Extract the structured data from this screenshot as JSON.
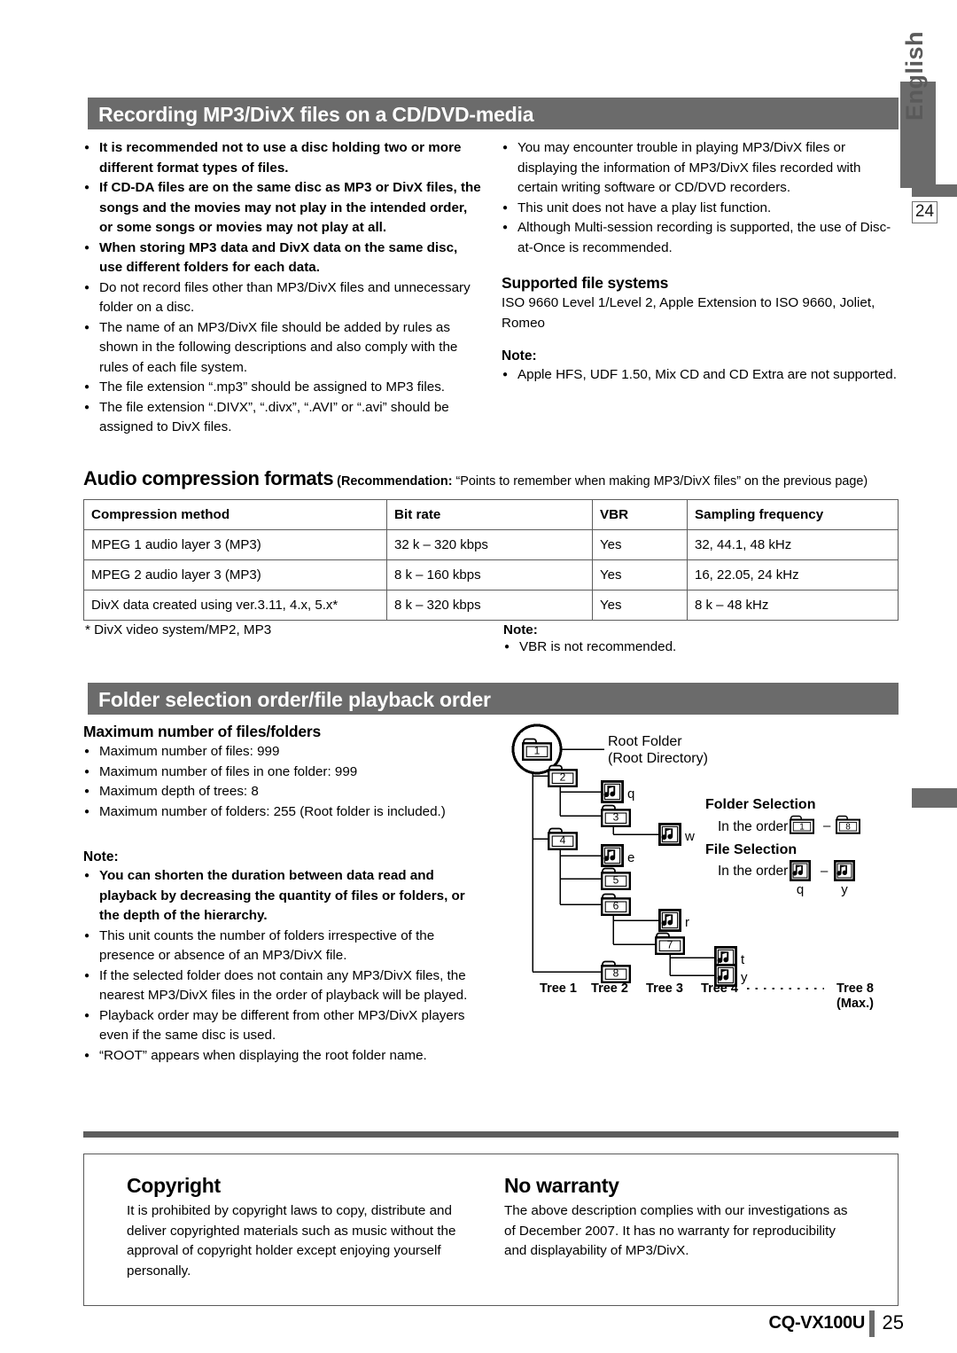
{
  "sidebar": {
    "language_label": "English",
    "page_reference": "24"
  },
  "sections": [
    {
      "id": "recording",
      "title": "Recording MP3/DivX files on a CD/DVD-media"
    },
    {
      "id": "folder-order",
      "title": "Folder selection order/file playback order"
    }
  ],
  "recording": {
    "left_bullets": [
      {
        "text": "It is recommended not to use a disc holding two or more different format types of files.",
        "bold": true
      },
      {
        "text": "If CD-DA files are on the same disc as MP3 or DivX files, the songs and the movies may not play in the intended order, or some songs or movies may not play at all.",
        "bold": true
      },
      {
        "text": "When storing MP3 data and DivX data on the same disc, use different folders for each data.",
        "bold": true
      },
      {
        "text": "Do not record files other than MP3/DivX files and unnecessary folder on a disc.",
        "bold": false
      },
      {
        "text": "The name of an MP3/DivX file should be added by rules as shown in the following descriptions and also comply with the rules of each file system.",
        "bold": false
      },
      {
        "text": "The file extension “.mp3” should be assigned to MP3 files.",
        "bold": false
      },
      {
        "text": "The file extension “.DIVX”, “.divx”, “.AVI” or “.avi” should be assigned to DivX files.",
        "bold": false
      }
    ],
    "right_bullets": [
      {
        "text": "You may encounter trouble in playing MP3/DivX files or displaying the information of MP3/DivX files recorded with certain writing software or CD/DVD recorders.",
        "bold": false
      },
      {
        "text": "This unit does not have a play list function.",
        "bold": false
      },
      {
        "text": "Although Multi-session recording is supported, the use of Disc-at-Once is recommended.",
        "bold": false
      }
    ],
    "supported_file_systems": {
      "heading": "Supported file systems",
      "body": "ISO 9660 Level 1/Level 2, Apple Extension to ISO 9660, Joliet, Romeo"
    },
    "note": {
      "heading": "Note:",
      "bullets": [
        "Apple HFS, UDF 1.50, Mix CD and CD Extra are not supported."
      ]
    }
  },
  "audio_formats": {
    "heading": "Audio compression formats",
    "recommendation_prefix": "(Recommendation:",
    "recommendation_rest": " “Points to remember when making MP3/DivX files” on the previous page)",
    "table": {
      "headers": [
        "Compression method",
        "Bit rate",
        "VBR",
        "Sampling frequency"
      ],
      "rows": [
        [
          "MPEG 1 audio layer 3 (MP3)",
          "32 k – 320 kbps",
          "Yes",
          "32, 44.1, 48 kHz"
        ],
        [
          "MPEG 2 audio layer 3 (MP3)",
          "8 k – 160 kbps",
          "Yes",
          "16, 22.05, 24 kHz"
        ],
        [
          "DivX data created using ver.3.11, 4.x, 5.x*",
          "8 k – 320 kbps",
          "Yes",
          "8 k – 48 kHz"
        ]
      ]
    },
    "footnote": "* DivX video system/MP2, MP3",
    "note": {
      "heading": "Note:",
      "bullets": [
        "VBR is not recommended."
      ]
    }
  },
  "folder_order": {
    "max_heading": "Maximum number of files/folders",
    "max_bullets": [
      {
        "text": "Maximum number of files: 999",
        "bold": false
      },
      {
        "text": "Maximum number of files in one folder: 999",
        "bold": false
      },
      {
        "text": "Maximum depth of trees: 8",
        "bold": false
      },
      {
        "text": "Maximum number of folders: 255 (Root folder is included.)",
        "bold": false
      }
    ],
    "note_heading": "Note:",
    "note_bullets": [
      {
        "text": "You can shorten the duration between data read and playback by decreasing the quantity of files or folders, or the depth of the hierarchy.",
        "bold": true
      },
      {
        "text": "This unit counts the number of folders irrespective of the presence or absence of an MP3/DivX file.",
        "bold": false
      },
      {
        "text": "If the selected folder does not contain any MP3/DivX files, the nearest MP3/DivX files in the order of playback will be played.",
        "bold": false
      },
      {
        "text": "Playback order may be different from other MP3/DivX players even if the same disc is used.",
        "bold": false
      },
      {
        "text": "“ROOT” appears when displaying the root folder name.",
        "bold": false
      }
    ],
    "diagram": {
      "root_label_line1": "Root Folder",
      "root_label_line2": "(Root Directory)",
      "folders": [
        "1",
        "2",
        "3",
        "4",
        "5",
        "6",
        "7",
        "8"
      ],
      "files": [
        "q",
        "w",
        "e",
        "r",
        "t",
        "y"
      ],
      "tree_labels": [
        "Tree 1",
        "Tree 2",
        "Tree 3",
        "Tree 4",
        "Tree 8"
      ],
      "tree_max_suffix": "(Max.)",
      "folder_selection": {
        "heading": "Folder Selection",
        "order_text": "In the order",
        "from": "1",
        "to": "8",
        "dash": "–"
      },
      "file_selection": {
        "heading": "File Selection",
        "order_text": "In the order",
        "from": "q",
        "to": "y",
        "dash": "–"
      }
    }
  },
  "copyright": {
    "heading": "Copyright",
    "body": "It is prohibited by copyright laws to copy, distribute and deliver copyrighted materials such as music without the approval of copyright holder except enjoying yourself personally."
  },
  "no_warranty": {
    "heading": "No warranty",
    "body": "The above description complies with our investigations as of December 2007. It has no warranty for reproducibility and displayability of MP3/DivX."
  },
  "footer": {
    "model": "CQ-VX100U",
    "page_number": "25"
  },
  "colors": {
    "header_bar": "#6b6b6b",
    "rule": "#5d5d5d",
    "text": "#000000"
  }
}
